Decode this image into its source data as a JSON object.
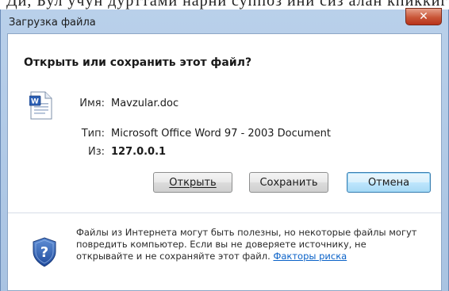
{
  "window": {
    "title": "Загрузка файла"
  },
  "top_strip": {
    "text": "Ди, Бул учун дурттами нарни суппоз ини сиз алан кпиккиг Киз Ди"
  },
  "dialog": {
    "question": "Открыть или сохранить этот файл?",
    "file_icon": "word-document-icon",
    "name_label": "Имя:",
    "name_value": "Mavzular.doc",
    "type_label": "Тип:",
    "type_value": "Microsoft Office Word 97 - 2003 Document",
    "from_label": "Из:",
    "from_value": "127.0.0.1",
    "buttons": {
      "open": "Открыть",
      "save": "Сохранить",
      "cancel": "Отмена"
    },
    "warning_text": "Файлы из Интернета могут быть полезны, но некоторые файлы могут повредить компьютер. Если вы не доверяете источнику, не открывайте и не сохраняйте этот файл.",
    "risk_link": "Факторы риска",
    "shield_icon": "security-shield-question-icon"
  },
  "colors": {
    "link": "#0a62c8",
    "close_button": "#c95638",
    "frame": "#b9d0ea"
  }
}
